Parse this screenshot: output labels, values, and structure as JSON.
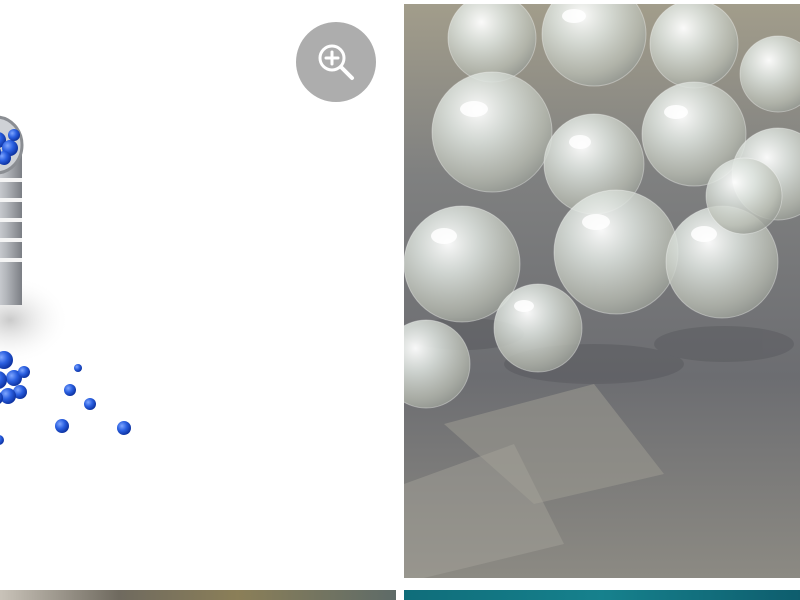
{
  "gallery": {
    "tiles": [
      {
        "subject": "blue-silica-gel-beads-in-container"
      },
      {
        "subject": "clear-water-beads-on-stone"
      },
      {
        "subject": "partial-image-bottom-left"
      },
      {
        "subject": "partial-image-bottom-right"
      }
    ],
    "zoom_button": {
      "icon": "zoom-in-icon"
    }
  },
  "colors": {
    "bead_blue": "#1f57d8",
    "bead_clear": "#e8eee9",
    "stone": "#77787a",
    "overlay": "#969696"
  }
}
